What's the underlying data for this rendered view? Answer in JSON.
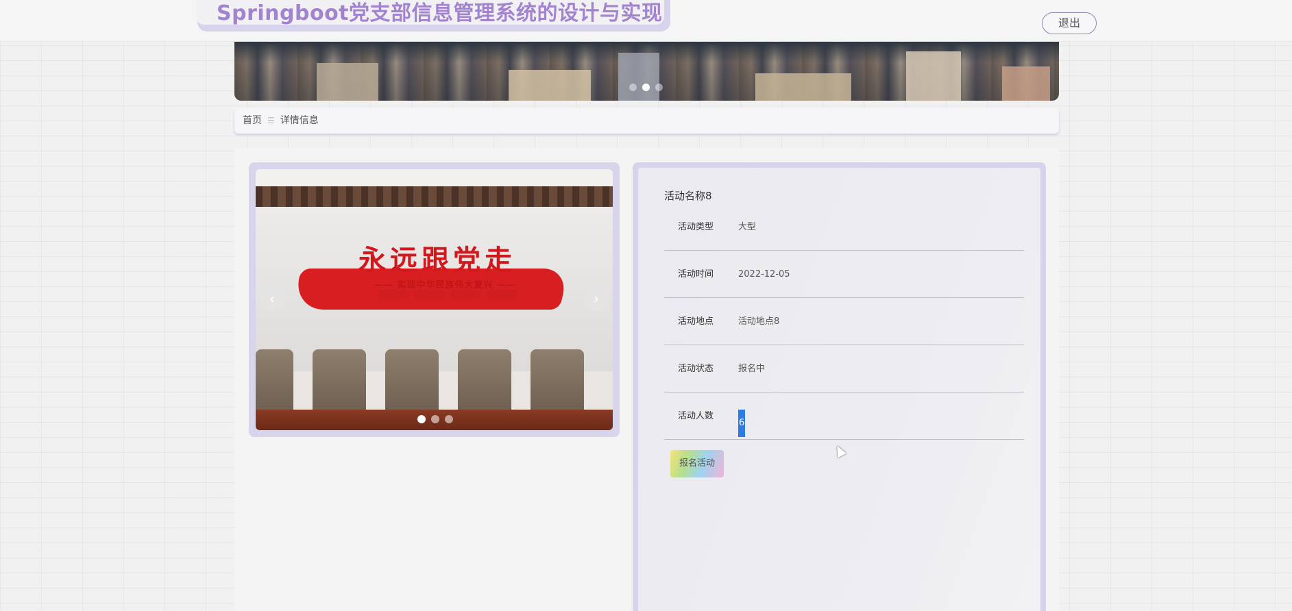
{
  "header": {
    "site_title": "Springboot党支部信息管理系统的设计与实现",
    "logout_label": "退出"
  },
  "banner": {
    "dots": 3,
    "active_dot": 2
  },
  "breadcrumb": {
    "home": "首页",
    "separator_icon": "separator-icon",
    "current": "详情信息"
  },
  "gallery": {
    "slogan": "永远跟党走",
    "subtitle": "—— 实现中华民族伟大复兴 ——",
    "tags": [
      "新时代",
      "新思想",
      "新目标",
      "新征程"
    ],
    "prev_icon": "chevron-left-icon",
    "next_icon": "chevron-right-icon",
    "dots": 3,
    "active_dot": 1
  },
  "detail": {
    "title": "活动名称8",
    "rows": [
      {
        "label": "活动类型",
        "value": "大型"
      },
      {
        "label": "活动时间",
        "value": "2022-12-05"
      },
      {
        "label": "活动地点",
        "value": "活动地点8"
      },
      {
        "label": "活动状态",
        "value": "报名中"
      },
      {
        "label": "活动人数",
        "value": "6"
      }
    ],
    "signup_label": "报名活动"
  },
  "colors": {
    "title": "#a283cf",
    "accent": "#d6d3ec",
    "selection": "#2f7be6"
  }
}
